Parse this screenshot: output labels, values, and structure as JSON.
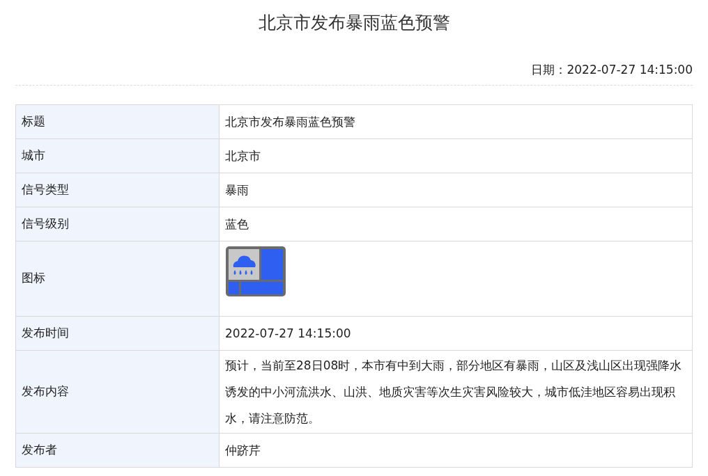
{
  "title": "北京市发布暴雨蓝色预警",
  "date": "日期：2022-07-27 14:15:00",
  "rows": [
    {
      "kind": "text",
      "label": "标题",
      "value": "北京市发布暴雨蓝色预警"
    },
    {
      "kind": "text",
      "label": "城市",
      "value": "北京市"
    },
    {
      "kind": "text",
      "label": "信号类型",
      "value": "暴雨"
    },
    {
      "kind": "text",
      "label": "信号级别",
      "value": "蓝色"
    },
    {
      "kind": "icon",
      "label": "图标",
      "color": "#2f5ff0"
    },
    {
      "kind": "text",
      "label": "发布时间",
      "value": "2022-07-27 14:15:00"
    },
    {
      "kind": "text",
      "label": "发布内容",
      "value": "预计，当前至28日08时，本市有中到大雨，部分地区有暴雨，山区及浅山区出现强降水诱发的中小河流洪水、山洪、地质灾害等次生灾害风险较大，城市低洼地区容易出现积水，请注意防范。"
    },
    {
      "kind": "text",
      "label": "发布者",
      "value": "仲跻芹"
    }
  ]
}
